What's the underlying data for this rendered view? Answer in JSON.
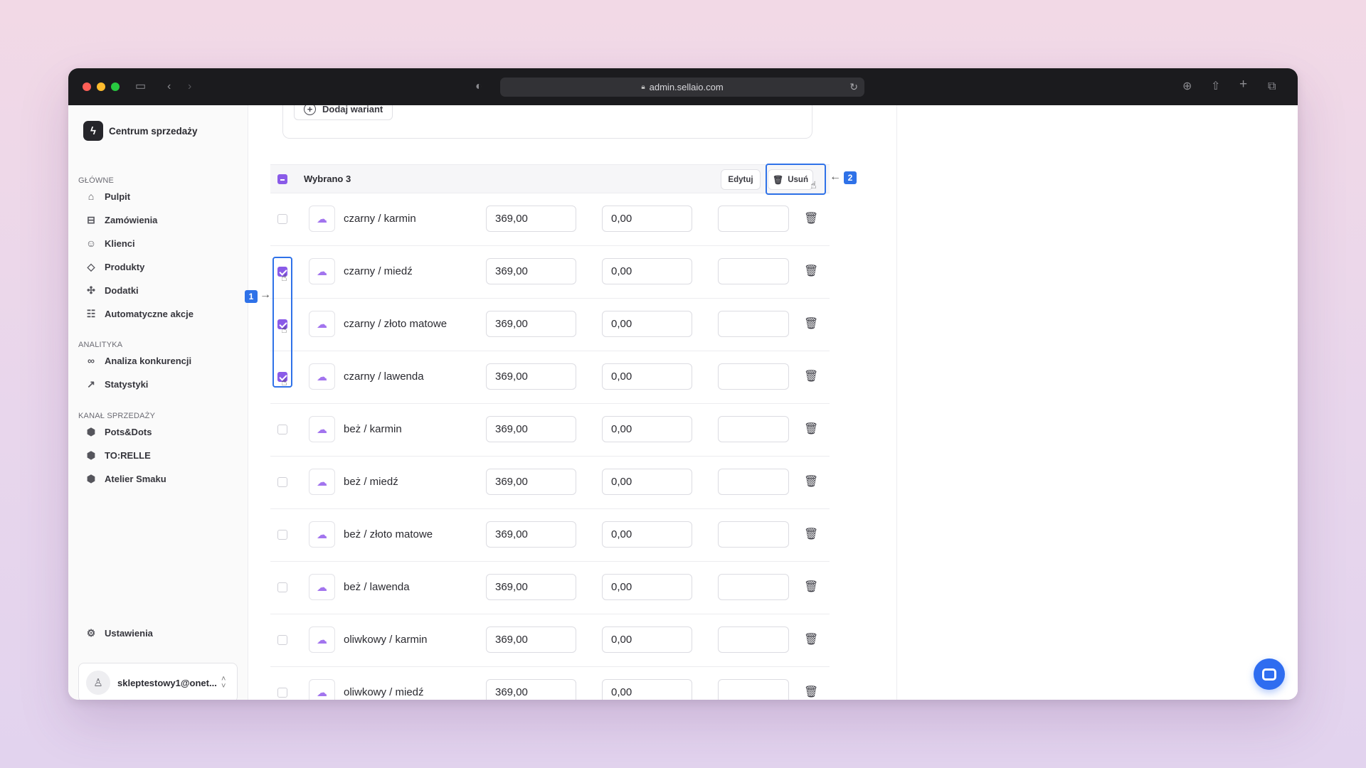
{
  "browser": {
    "url": "admin.sellaio.com",
    "traffic_colors": [
      "#ff5f57",
      "#febc2e",
      "#28c840"
    ]
  },
  "sidebar": {
    "brand": "Centrum sprzedaży",
    "sections": [
      {
        "label": "GŁÓWNE",
        "items": [
          {
            "label": "Pulpit",
            "icon": "home-icon"
          },
          {
            "label": "Zamówienia",
            "icon": "inbox-icon"
          },
          {
            "label": "Klienci",
            "icon": "user-icon"
          },
          {
            "label": "Produkty",
            "icon": "tag-icon"
          },
          {
            "label": "Dodatki",
            "icon": "puzzle-icon"
          },
          {
            "label": "Automatyczne akcje",
            "icon": "workflow-icon"
          }
        ]
      },
      {
        "label": "ANALITYKA",
        "items": [
          {
            "label": "Analiza konkurencji",
            "icon": "binoculars-icon"
          },
          {
            "label": "Statystyki",
            "icon": "trend-icon"
          }
        ]
      },
      {
        "label": "KANAŁ SPRZEDAŻY",
        "items": [
          {
            "label": "Pots&Dots",
            "icon": "store-icon"
          },
          {
            "label": "TO:RELLE",
            "icon": "store-icon"
          },
          {
            "label": "Atelier Smaku",
            "icon": "store-icon"
          }
        ]
      }
    ],
    "settings": "Ustawienia",
    "user_email": "skleptestowy1@onet..."
  },
  "main": {
    "add_variant": "Dodaj wariant",
    "selection_text": "Wybrano 3",
    "edit_button": "Edytuj",
    "delete_button": "Usuń",
    "rows": [
      {
        "name": "czarny / karmin",
        "price": "369,00",
        "second": "0,00",
        "third": "",
        "checked": false
      },
      {
        "name": "czarny / miedź",
        "price": "369,00",
        "second": "0,00",
        "third": "",
        "checked": true
      },
      {
        "name": "czarny / złoto matowe",
        "price": "369,00",
        "second": "0,00",
        "third": "",
        "checked": true
      },
      {
        "name": "czarny / lawenda",
        "price": "369,00",
        "second": "0,00",
        "third": "",
        "checked": true
      },
      {
        "name": "beż / karmin",
        "price": "369,00",
        "second": "0,00",
        "third": "",
        "checked": false
      },
      {
        "name": "beż / miedź",
        "price": "369,00",
        "second": "0,00",
        "third": "",
        "checked": false
      },
      {
        "name": "beż / złoto matowe",
        "price": "369,00",
        "second": "0,00",
        "third": "",
        "checked": false
      },
      {
        "name": "beż / lawenda",
        "price": "369,00",
        "second": "0,00",
        "third": "",
        "checked": false
      },
      {
        "name": "oliwkowy / karmin",
        "price": "369,00",
        "second": "0,00",
        "third": "",
        "checked": false
      },
      {
        "name": "oliwkowy / miedź",
        "price": "369,00",
        "second": "0,00",
        "third": "",
        "checked": false
      }
    ]
  },
  "annotations": {
    "badge1": "1",
    "badge2": "2"
  },
  "colors": {
    "accent": "#8a5be8",
    "annotation": "#2f72e8"
  }
}
